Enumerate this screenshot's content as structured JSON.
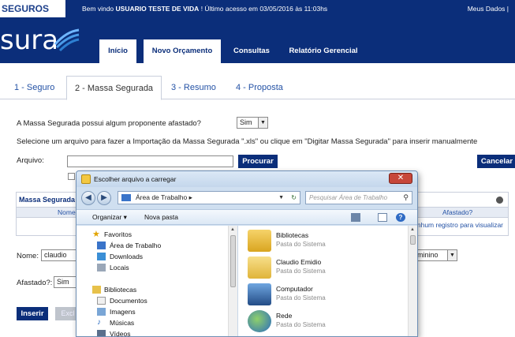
{
  "topbar": {
    "brand": "SEGUROS",
    "welcome_prefix": "Bem vindo ",
    "user": "USUARIO TESTE DE VIDA",
    "welcome_suffix": " ! Último acesso em 03/05/2016 às 11:03hs",
    "meus_dados": "Meus Dados  |"
  },
  "header": {
    "logo": "sura",
    "nav": [
      "Início",
      "Novo Orçamento",
      "Consultas",
      "Relatório Gerencial"
    ]
  },
  "steps": [
    "1 - Seguro",
    "2 - Massa Segurada",
    "3 - Resumo",
    "4 - Proposta"
  ],
  "form": {
    "afastado_question": "A Massa Segurada possui algum proponente afastado?",
    "afastado_question_value": "Sim",
    "import_instruction": "Selecione um arquivo para fazer a Importação da Massa Segurada \".xls\" ou clique em \"Digitar Massa Segurada\" para inserir manualmente",
    "arquivo_label": "Arquivo:",
    "procurar": "Procurar",
    "cancelar": "Cancelar",
    "nome_label": "Nome:",
    "nome_value": "claudio",
    "sexo_value": "eminino",
    "afastado_label": "Afastado?:",
    "afastado_value": "Sim",
    "inserir": "Inserir",
    "excluir": "Excl"
  },
  "panel": {
    "title": "Massa Segurada",
    "col_nome": "Nome",
    "col_afastado": "Afastado?",
    "empty": "Nenhum registro para visualizar"
  },
  "dialog": {
    "title": "Escolher arquivo a carregar",
    "address": "Área de Trabalho",
    "search_placeholder": "Pesquisar Área de Trabalho",
    "organizar": "Organizar ▾",
    "nova_pasta": "Nova pasta",
    "nav": {
      "favoritos": "Favoritos",
      "favoritos_items": [
        "Área de Trabalho",
        "Downloads",
        "Locais"
      ],
      "bibliotecas": "Bibliotecas",
      "bibliotecas_items": [
        "Documentos",
        "Imagens",
        "Músicas",
        "Vídeos"
      ]
    },
    "files": [
      {
        "name": "Bibliotecas",
        "type": "Pasta do Sistema",
        "icon": "libraries-icon"
      },
      {
        "name": "Claudio Emidio",
        "type": "Pasta do Sistema",
        "icon": "user-folder-icon"
      },
      {
        "name": "Computador",
        "type": "Pasta do Sistema",
        "icon": "computer-icon"
      },
      {
        "name": "Rede",
        "type": "Pasta do Sistema",
        "icon": "network-icon"
      }
    ]
  }
}
